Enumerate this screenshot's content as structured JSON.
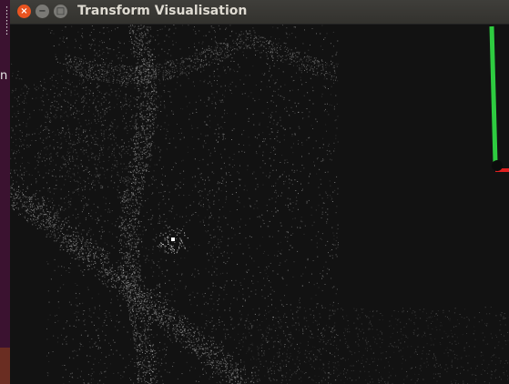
{
  "window": {
    "title": "Transform Visualisation",
    "controls": {
      "close_icon": "close-icon",
      "minimize_icon": "minimize-icon",
      "maximize_icon": "maximize-icon"
    }
  },
  "background_window": {
    "visible_char": "n"
  },
  "viewport": {
    "content": "point-cloud",
    "axes": {
      "y_axis_color": "#2ecc40",
      "x_axis_color": "#e02020",
      "z_axis_color": "#101010"
    },
    "colors": {
      "background": "#121212",
      "points": "#a8a8a8",
      "marker": "#ffffff"
    }
  }
}
